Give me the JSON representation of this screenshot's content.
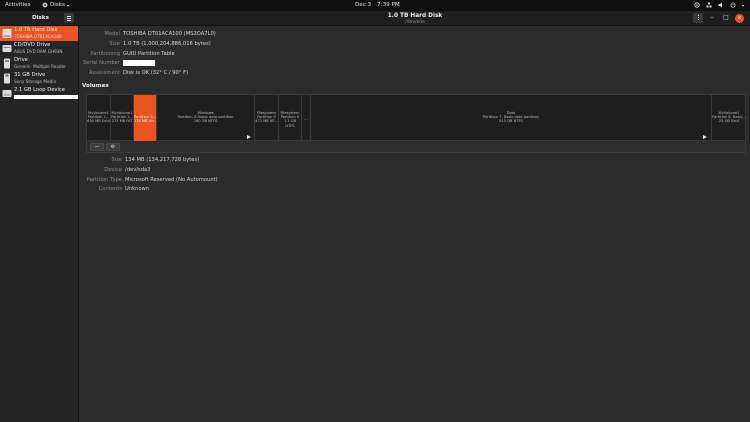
{
  "topbar": {
    "activities": "Activities",
    "app_name": "Disks",
    "date": "Dec 3",
    "time": "7:39 PM"
  },
  "header": {
    "sidebar_title": "Disks",
    "title": "1.0 TB Hard Disk",
    "subtitle": "/dev/sda",
    "close_glyph": "×",
    "minimize_glyph": "–",
    "maximize_glyph": "□"
  },
  "sidebar": {
    "drives": [
      {
        "name": "1.0 TB Hard Disk",
        "detail": "TOSHIBA DT01ACA100",
        "icon": "hard-disk-icon",
        "selected": true
      },
      {
        "name": "CD/DVD Drive",
        "detail": "ASUS DVD RAM GH93N",
        "icon": "optical-drive-icon",
        "selected": false
      },
      {
        "name": "Drive",
        "detail": "Generic- Multiple Reader",
        "icon": "card-reader-icon",
        "selected": false
      },
      {
        "name": "31 GB Drive",
        "detail": "Sony Storage Media",
        "icon": "usb-drive-icon",
        "selected": false
      },
      {
        "name": "2.1 GB Loop Device",
        "detail": "",
        "icon": "loop-device-icon",
        "selected": false
      }
    ]
  },
  "disk_info": {
    "model_label": "Model",
    "model": "TOSHIBA DT01ACA100 (MS2OA7L0)",
    "size_label": "Size",
    "size": "1.0 TB (1,000,204,886,016 bytes)",
    "partitioning_label": "Partitioning",
    "partitioning": "GUID Partition Table",
    "serial_label": "Serial Number",
    "assessment_label": "Assessment",
    "assessment": "Disk is OK (32° C / 90° F)"
  },
  "volumes": {
    "title": "Volumes",
    "partitions": [
      {
        "line1": "MyVolume1",
        "line2": "Partition 1...",
        "line3": "630 MB Ext4",
        "selected": false,
        "play": false
      },
      {
        "line1": "MyVolume1",
        "line2": "Partition 2...",
        "line3": "273 MB FAT",
        "selected": false,
        "play": false
      },
      {
        "line1": "",
        "line2": "Partition 3...",
        "line3": "134 MB Un...",
        "selected": true,
        "play": false
      },
      {
        "line1": "Windows",
        "line2": "Partition 4: Basic data partition",
        "line3": "160 GB NTFS",
        "selected": false,
        "play": true
      },
      {
        "line1": "Filesystem",
        "line2": "Partition 5",
        "line3": "472 MB NT...",
        "selected": false,
        "play": false
      },
      {
        "line1": "Filesystem",
        "line2": "Partition 6",
        "line3": "1.1 GB NTFS",
        "selected": false,
        "play": false
      },
      {
        "line1": "",
        "line2": "",
        "line3": "...",
        "selected": false,
        "play": false
      },
      {
        "line1": "Data",
        "line2": "Partition 7: Basic data partition",
        "line3": "815 GB NTFS",
        "selected": false,
        "play": true
      },
      {
        "line1": "MyVolume1",
        "line2": "Partition 8: Basic...",
        "line3": "23 GB Ext4",
        "selected": false,
        "play": false
      }
    ],
    "toolbar": {
      "remove_glyph": "—",
      "settings_glyph": "⚙"
    }
  },
  "partition_detail": {
    "size_label": "Size",
    "size": "134 MB (134,217,728 bytes)",
    "device_label": "Device",
    "device": "/dev/sda3",
    "type_label": "Partition Type",
    "type": "Microsoft Reserved (No Automount)",
    "contents_label": "Contents",
    "contents": "Unknown"
  },
  "colors": {
    "accent": "#e95420",
    "background": "#2b2b2b",
    "sidebar": "#252525",
    "topbar": "#0f0f0f"
  }
}
